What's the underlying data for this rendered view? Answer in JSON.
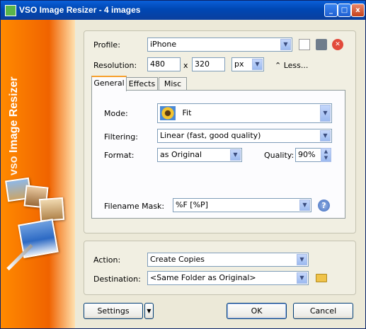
{
  "window": {
    "title": "VSO Image Resizer - 4 images",
    "minimize": "_",
    "maximize": "□",
    "close": "x"
  },
  "sidebar": {
    "product_name": "Image Resizer",
    "brand": "vso"
  },
  "top": {
    "profile_label": "Profile:",
    "profile_value": "iPhone",
    "resolution_label": "Resolution:",
    "width": "480",
    "x_sep": "x",
    "height": "320",
    "unit": "px",
    "less_link": "Less..."
  },
  "tabs": [
    {
      "label": "General"
    },
    {
      "label": "Effects"
    },
    {
      "label": "Misc"
    }
  ],
  "general": {
    "mode_label": "Mode:",
    "mode_value": "Fit",
    "filtering_label": "Filtering:",
    "filtering_value": "Linear  (fast, good quality)",
    "format_label": "Format:",
    "format_value": "as Original",
    "quality_label": "Quality:",
    "quality_value": "90%",
    "mask_label": "Filename Mask:",
    "mask_value": "%F [%P]"
  },
  "bottom": {
    "action_label": "Action:",
    "action_value": "Create Copies",
    "destination_label": "Destination:",
    "destination_value": "<Same Folder as Original>"
  },
  "buttons": {
    "settings": "Settings",
    "ok": "OK",
    "cancel": "Cancel"
  },
  "colors": {
    "title_bar": "#0047b3",
    "sidebar": "#f06300",
    "tab_accent": "#f7a02d"
  }
}
